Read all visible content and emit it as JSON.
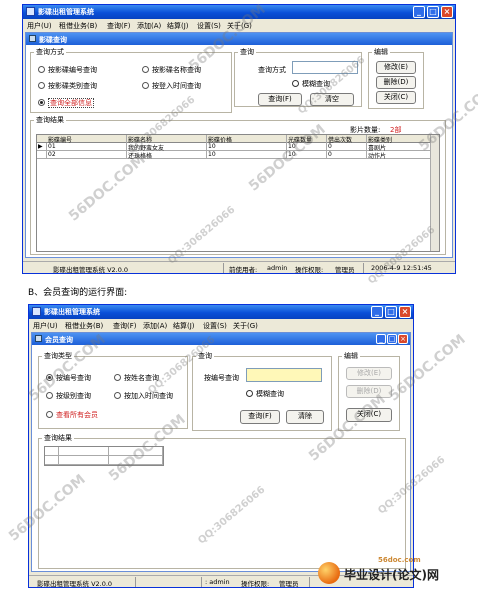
{
  "caption": "B、会员查询的运行界面:",
  "logo": {
    "url": "56doc.com",
    "name": "毕业设计(论文)网"
  },
  "watermarks": [
    "56DOC.COM",
    "QQ:306826066"
  ],
  "win1": {
    "title": "影碟出租管理系统",
    "menu": [
      "用户(U)",
      "租借业务(B)",
      "查询(F)",
      "添加(A)",
      "结算(J)",
      "设置(S)",
      "关于(G)"
    ],
    "child_title": "影碟查询",
    "query_group": {
      "legend": "查询方式",
      "options": [
        "按影碟编号查询",
        "按影碟名称查询",
        "按影碟类别查询",
        "按登入时间查询",
        "查询全部信息"
      ],
      "selected": 4
    },
    "search_group": {
      "legend": "查询",
      "label": "查询方式",
      "value": "",
      "fuzzy": "模糊查询",
      "query_btn": "查询(F)",
      "clear_btn": "清空"
    },
    "edit_group": {
      "legend": "编辑",
      "buttons": [
        "修改(E)",
        "删除(D)",
        "关闭(C)"
      ]
    },
    "results": {
      "legend": "查询结果",
      "count_label": "影片数量:",
      "count_value": "2部",
      "columns": [
        "影碟编号",
        "影碟名称",
        "影碟价格",
        "光碟数量",
        "借出次数",
        "影碟类别"
      ],
      "rows": [
        [
          "01",
          "我的野蛮女友",
          "10",
          "10",
          "0",
          "喜剧片"
        ],
        [
          "02",
          "还珠格格",
          "10",
          "10",
          "0",
          "动作片"
        ]
      ]
    },
    "status": {
      "app": "影碟出租管理系统  V2.0.0",
      "user_label": "前使用者:",
      "user": "admin",
      "perm_label": "操作权限:",
      "perm": "管理员",
      "time": "2006-4-9 12:51:45"
    }
  },
  "win2": {
    "title": "影碟出租管理系统",
    "menu": [
      "用户(U)",
      "租借业务(B)",
      "查询(F)",
      "添加(A)",
      "结算(J)",
      "设置(S)",
      "关于(G)"
    ],
    "child_title": "会员查询",
    "query_group": {
      "legend": "查询类型",
      "options": [
        "按编号查询",
        "按姓名查询",
        "按级别查询",
        "按加入时间查询",
        "查看所有会员"
      ],
      "selected": 0
    },
    "search_group": {
      "legend": "查询",
      "label": "按编号查询",
      "value": "",
      "fuzzy": "模糊查询",
      "query_btn": "查询(F)",
      "clear_btn": "清除"
    },
    "edit_group": {
      "legend": "编辑",
      "buttons": [
        "修改(E)",
        "删除(D)",
        "关闭(C)"
      ]
    },
    "results": {
      "legend": "查询结果"
    },
    "status": {
      "app": "影碟出租管理系统  V2.0.0",
      "user": ": admin",
      "perm_label": "操作权限:",
      "perm": "管理员"
    }
  }
}
